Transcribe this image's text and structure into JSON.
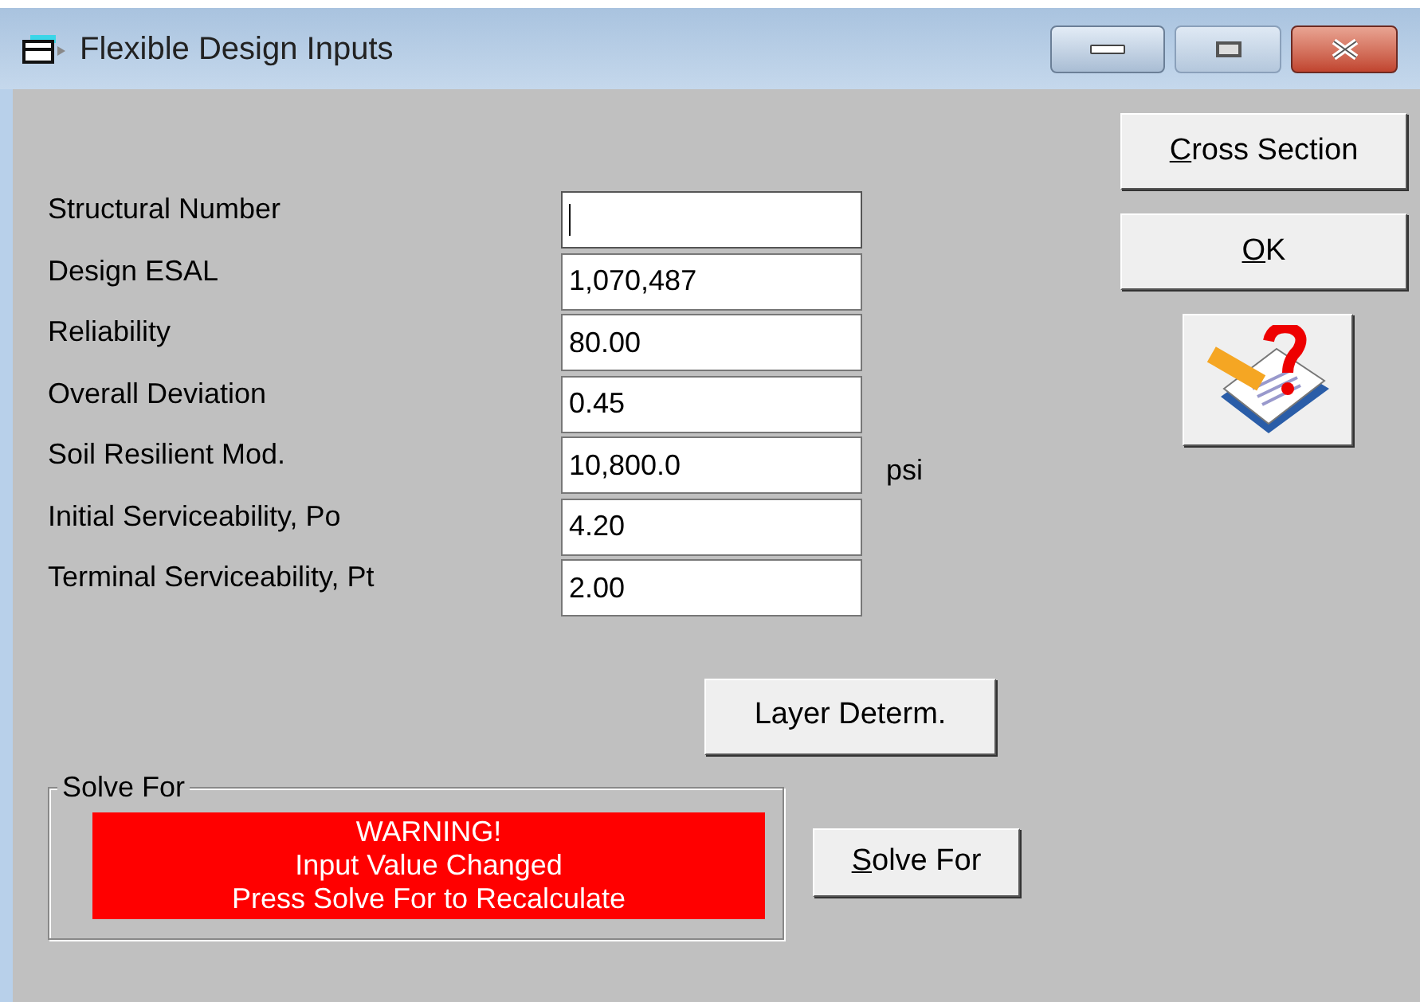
{
  "window": {
    "title": "Flexible Design Inputs"
  },
  "fields": [
    {
      "label": "Structural Number",
      "focused": true
    },
    {
      "label": "Design ESAL",
      "value": "1,070,487",
      "focused": false
    },
    {
      "label": "Reliability",
      "value": "80.00",
      "focused": false
    },
    {
      "label": "Overall Deviation",
      "value": "0.45",
      "focused": false
    },
    {
      "label": "Soil Resilient Mod.",
      "value": "10,800.0",
      "unit": "psi",
      "focused": false
    },
    {
      "label": "Initial Serviceability, Po",
      "value": "4.20",
      "focused": false
    },
    {
      "label": "Terminal Serviceability, Pt",
      "value": "2.00",
      "focused": false
    }
  ],
  "side_buttons": [
    {
      "label": "Cross Section",
      "underline_first": true
    },
    {
      "label": "OK",
      "underline_first": true
    }
  ],
  "layer_button": {
    "label": "Layer Determ."
  },
  "solve_group": {
    "title": "Solve For",
    "warning": [
      "WARNING!",
      "Input Value Changed",
      "Press Solve For to Recalculate"
    ],
    "button": {
      "label": "Solve For",
      "underline_first": true
    }
  }
}
